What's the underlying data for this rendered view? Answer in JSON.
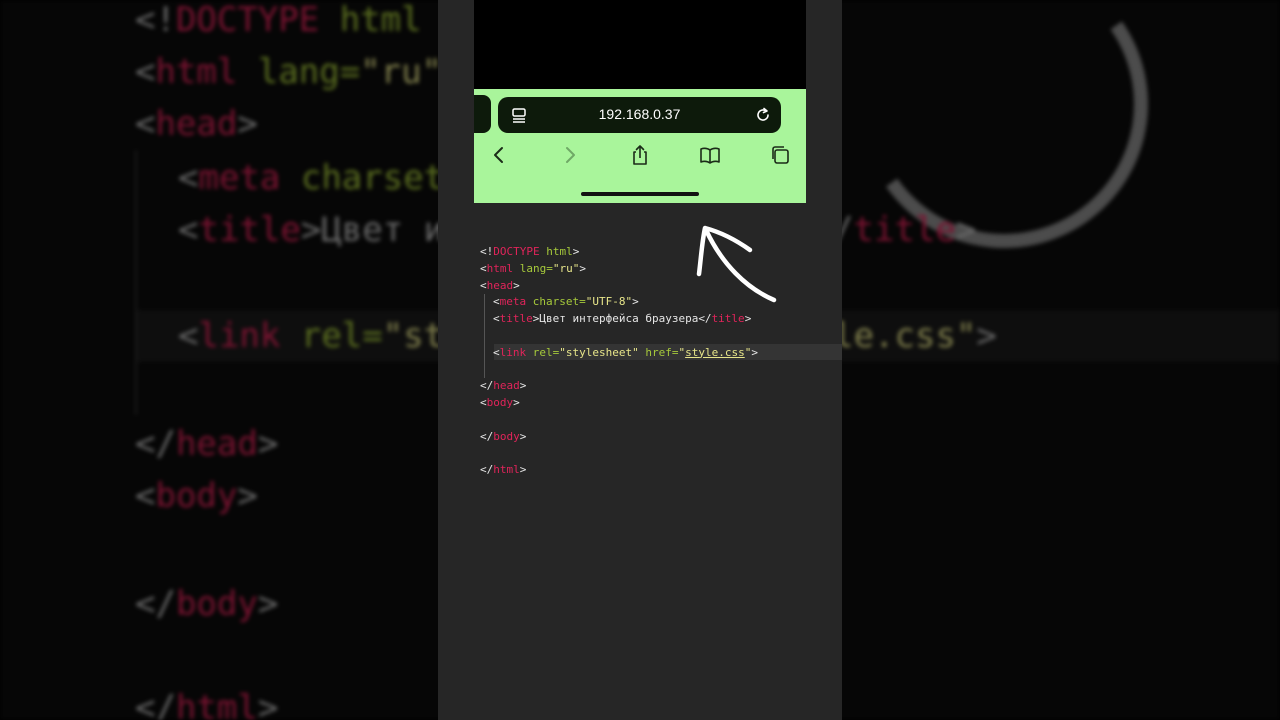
{
  "browser": {
    "url": "192.168.0.37",
    "toolbar_color": "#a9f59b",
    "icons": [
      "page-menu-icon",
      "reload-icon",
      "back-icon",
      "forward-icon",
      "share-icon",
      "bookmarks-icon",
      "tabs-icon"
    ]
  },
  "code": {
    "l1": {
      "open": "<!",
      "kw": "DOCTYPE",
      "rest": " html",
      "close": ">"
    },
    "l2": {
      "open": "<",
      "tag": "html",
      "attr": " lang=",
      "val": "\"ru\"",
      "close": ">"
    },
    "l3": {
      "open": "<",
      "tag": "head",
      "close": ">"
    },
    "l4": {
      "open": "<",
      "tag": "meta",
      "attr": " charset=",
      "val": "\"UTF-8\"",
      "close": ">"
    },
    "l5": {
      "open": "<",
      "tag": "title",
      "mid": ">Цвет интерфейса браузера</",
      "tag2": "title",
      "close": ">"
    },
    "l6": {
      "open": "<",
      "tag": "link",
      "attr1": " rel=",
      "val1": "\"stylesheet\"",
      "attr2": " href=",
      "q1": "\"",
      "val2": "style.css",
      "q2": "\"",
      "close": ">"
    },
    "l7": {
      "open": "</",
      "tag": "head",
      "close": ">"
    },
    "l8": {
      "open": "<",
      "tag": "body",
      "close": ">"
    },
    "l9": {
      "open": "</",
      "tag": "body",
      "close": ">"
    },
    "l10": {
      "open": "</",
      "tag": "html",
      "close": ">"
    }
  },
  "colors": {
    "tag": "#e0245a",
    "attribute": "#a6c93b",
    "string": "#e7e58a",
    "editor_bg": "#262626"
  }
}
